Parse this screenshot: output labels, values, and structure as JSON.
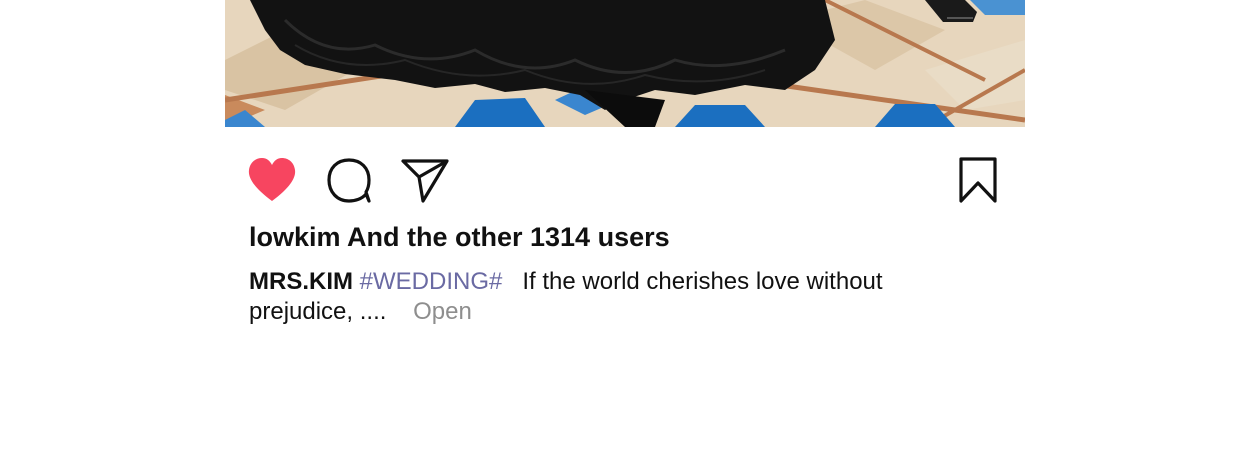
{
  "post": {
    "likes_text": "lowkim And the other 1314 users",
    "caption": {
      "username": "MRS.KIM",
      "hashtag": "#WEDDING#",
      "text_line1": "If the world cherishes love without",
      "text_line2": "prejudice, ....",
      "open_label": "Open"
    }
  },
  "actions": {
    "like_icon": "heart-filled",
    "comment_icon": "speech-bubble",
    "share_icon": "paper-plane",
    "save_icon": "bookmark"
  },
  "colors": {
    "like": "#f74560",
    "hashtag": "#6a6aa3",
    "open": "#8e8e8e",
    "text": "#111111"
  }
}
